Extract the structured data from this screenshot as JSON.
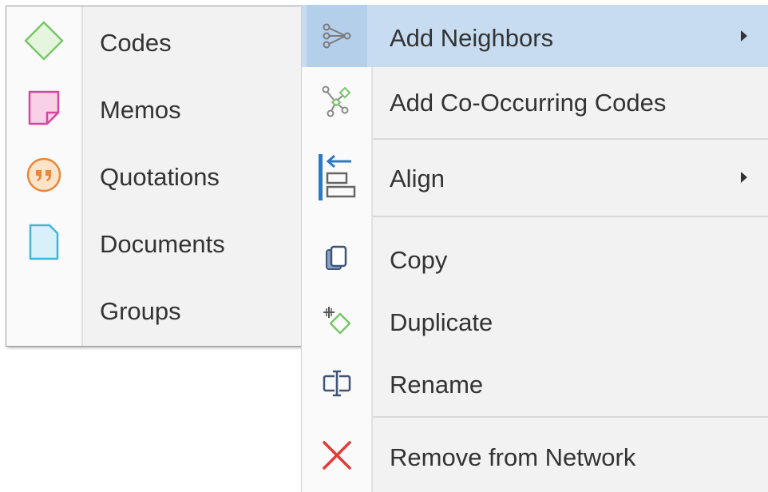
{
  "insert_menu": {
    "items": [
      {
        "label": "Codes",
        "icon": "code-diamond-icon"
      },
      {
        "label": "Memos",
        "icon": "memo-note-icon"
      },
      {
        "label": "Quotations",
        "icon": "quotation-icon"
      },
      {
        "label": "Documents",
        "icon": "document-icon"
      },
      {
        "label": "Groups",
        "icon": ""
      }
    ]
  },
  "context_menu": {
    "items": [
      {
        "label": "Add Neighbors",
        "icon": "add-neighbors-icon",
        "submenu": true,
        "highlighted": true
      },
      {
        "label": "Add Co-Occurring Codes",
        "icon": "co-occurring-codes-icon"
      },
      {
        "label": "Align",
        "icon": "align-left-icon",
        "submenu": true
      },
      {
        "label": "Copy",
        "icon": "copy-icon"
      },
      {
        "label": "Duplicate",
        "icon": "duplicate-icon"
      },
      {
        "label": "Rename",
        "icon": "rename-icon"
      },
      {
        "label": "Remove from Network",
        "icon": "remove-icon"
      }
    ]
  },
  "colors": {
    "menu_bg": "#f2f2f2",
    "highlight": "#c7dcf1",
    "code_green": "#79c76a",
    "memo_pink": "#d9449c",
    "quotation_orange": "#e8873a",
    "document_blue": "#3fb6d8",
    "align_blue": "#2e79c4",
    "remove_red": "#e53935"
  }
}
